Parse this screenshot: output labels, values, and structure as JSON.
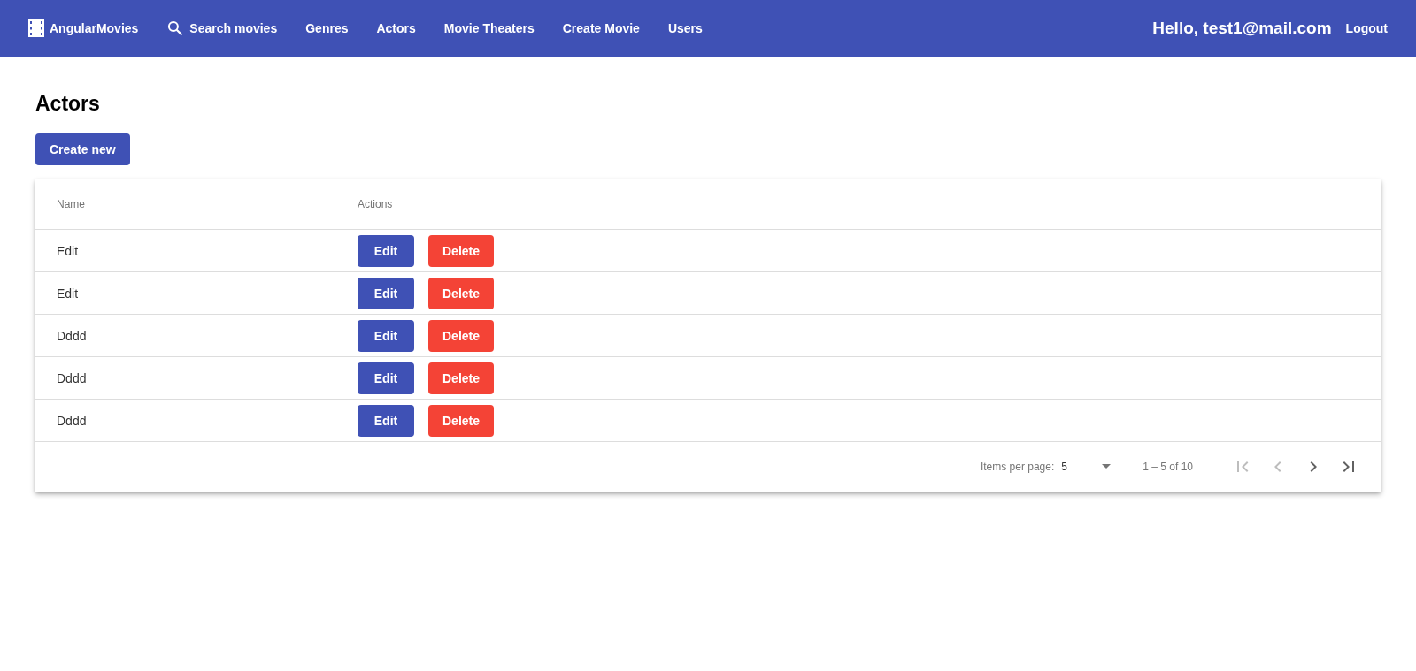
{
  "navbar": {
    "brand": "AngularMovies",
    "items": [
      {
        "label": "Search movies",
        "kind": "search"
      },
      {
        "label": "Genres",
        "kind": "link"
      },
      {
        "label": "Actors",
        "kind": "link"
      },
      {
        "label": "Movie Theaters",
        "kind": "link"
      },
      {
        "label": "Create Movie",
        "kind": "link"
      },
      {
        "label": "Users",
        "kind": "link"
      }
    ],
    "greeting": "Hello, test1@mail.com",
    "logout": "Logout"
  },
  "page": {
    "title": "Actors",
    "create_button": "Create new"
  },
  "table": {
    "columns": [
      "Name",
      "Actions"
    ],
    "rows": [
      {
        "name": "Edit",
        "edit": "Edit",
        "delete": "Delete"
      },
      {
        "name": "Edit",
        "edit": "Edit",
        "delete": "Delete"
      },
      {
        "name": "Dddd",
        "edit": "Edit",
        "delete": "Delete"
      },
      {
        "name": "Dddd",
        "edit": "Edit",
        "delete": "Delete"
      },
      {
        "name": "Dddd",
        "edit": "Edit",
        "delete": "Delete"
      }
    ]
  },
  "paginator": {
    "items_per_page_label": "Items per page:",
    "page_size": "5",
    "range": "1 – 5 of 10",
    "buttons": [
      {
        "kind": "first",
        "disabled": true
      },
      {
        "kind": "previous",
        "disabled": true
      },
      {
        "kind": "next",
        "disabled": false
      },
      {
        "kind": "last",
        "disabled": false
      }
    ]
  }
}
